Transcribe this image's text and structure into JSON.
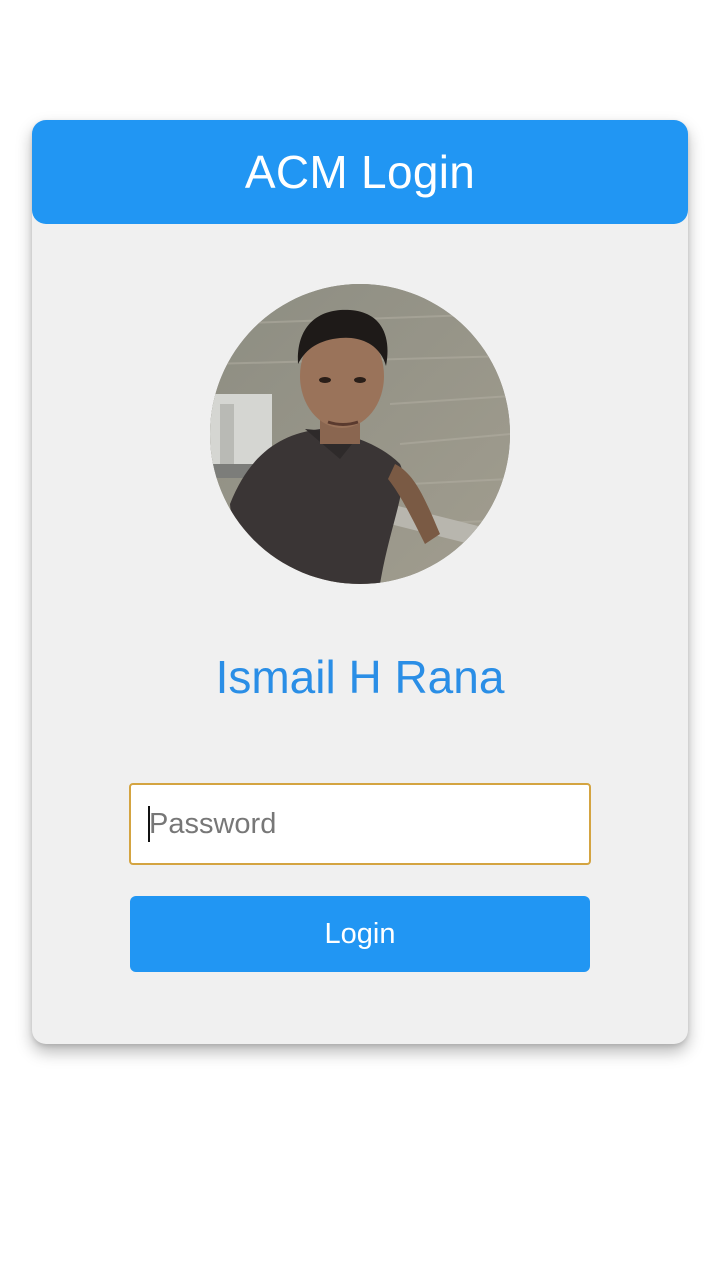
{
  "header": {
    "title": "ACM Login"
  },
  "profile": {
    "name": "Ismail H Rana",
    "avatar_icon": "user-photo"
  },
  "form": {
    "password_placeholder": "Password",
    "password_value": "",
    "login_label": "Login"
  },
  "colors": {
    "primary": "#2196f3",
    "name_text": "#2a8ee6",
    "card_background": "#f0f0f0",
    "input_focus_border": "#d4a441"
  }
}
